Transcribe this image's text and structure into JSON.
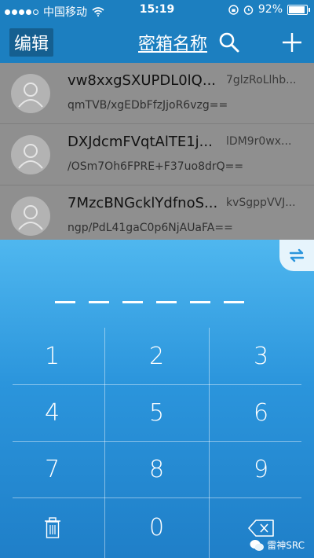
{
  "status_bar": {
    "carrier": "中国移动",
    "time": "15:19",
    "battery_percent": "92%",
    "battery_level": 0.92
  },
  "nav": {
    "edit_label": "编辑",
    "title": "密箱名称",
    "search_icon": "search-icon",
    "add_icon": "plus-icon"
  },
  "entries": [
    {
      "title": "vw8xxgSXUPDL0lQ...",
      "tag": "7glzRoLlhb...",
      "subtitle": "qmTVB/xgEDbFfzJjoR6vzg=="
    },
    {
      "title": "DXJdcmFVqtAlTE1j...",
      "tag": "lDM9r0wx...",
      "subtitle": "/OSm7Oh6FPRE+F37uo8drQ=="
    },
    {
      "title": "7MzcBNGcklYdfnoS...",
      "tag": "kvSgppVVJ...",
      "subtitle": "ngp/PdL41gaC0p6NjAUaFA=="
    }
  ],
  "pin": {
    "length": 6,
    "entered": 0
  },
  "keypad": {
    "keys": [
      "1",
      "2",
      "3",
      "4",
      "5",
      "6",
      "7",
      "8",
      "9",
      "",
      "0",
      ""
    ],
    "trash_icon": "trash-icon",
    "backspace_icon": "backspace-icon",
    "switch_icon": "switch-keyboard-icon"
  },
  "watermark": {
    "text": "雷神SRC"
  },
  "colors": {
    "accent": "#1c7fc0",
    "keypad_top": "#4fb7ef",
    "keypad_bottom": "#1f7fc8",
    "list_dim": "#8f8f8f"
  }
}
